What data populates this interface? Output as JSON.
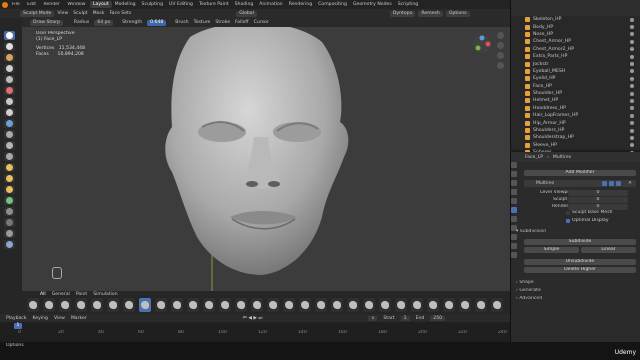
{
  "menu": {
    "items": [
      "File",
      "Edit",
      "Render",
      "Window",
      "Help"
    ]
  },
  "workspace_tabs": [
    "Layout",
    "Modeling",
    "Sculpting",
    "UV Editing",
    "Texture Paint",
    "Shading",
    "Animation",
    "Rendering",
    "Compositing",
    "Geometry Nodes",
    "Scripting"
  ],
  "scene_label": "Scene",
  "viewlayer_label": "ViewLayer",
  "viewport_header": {
    "mode": "Sculpt Mode",
    "items": [
      "View",
      "Sculpt",
      "Mask",
      "Face Sets"
    ],
    "global": "Global",
    "dyntopo": "Dyntopo",
    "remesh": "Remesh",
    "options": "Options"
  },
  "tool_header": {
    "brush_name": "Draw Sharp",
    "radius_label": "Radius",
    "radius_value": "64 px",
    "strength_label": "Strength",
    "strength_value": "0.648",
    "menus": [
      "Brush",
      "Texture",
      "Stroke",
      "Falloff",
      "Cursor"
    ]
  },
  "viewport_info": {
    "line1": "User Perspective",
    "line2": "(1) Face_LP",
    "vertices_label": "Vertices",
    "vertices_value": "11,534,448",
    "faces_label": "Faces",
    "faces_value": "10,894,208"
  },
  "brush_tabs": [
    "All",
    "General",
    "Paint",
    "Simulation"
  ],
  "timeline": {
    "items": [
      "Playback",
      "Keying",
      "View",
      "Marker"
    ],
    "current_frame": "1",
    "start_label": "Start",
    "start_value": "1",
    "end_label": "End",
    "end_value": "250",
    "ticks": [
      "0",
      "20",
      "40",
      "60",
      "80",
      "100",
      "120",
      "140",
      "160",
      "180",
      "200",
      "220",
      "240"
    ]
  },
  "status": {
    "left": "Options"
  },
  "outliner": {
    "items": [
      "Skeleton_HP",
      "Body_HP",
      "Nose_HP",
      "Chest_Armor_HP",
      "Chest_Armor2_HP",
      "Extra_Parts_HP",
      "Jockstr",
      "Eyeball_MESH",
      "Eyelid_HP",
      "Face_HP",
      "Shoulder_HP",
      "Helmet_HP",
      "Headdress_HP",
      "Hair_LopFrames_HP",
      "Hip_Armor_HP",
      "Shoulders_HP",
      "Shoulderstrap_HP",
      "Sleeve_HP",
      "Spheres",
      "UpperLongHair_HP"
    ]
  },
  "properties": {
    "breadcrumb_object": "Face_LP",
    "breadcrumb_modifier": "Multires",
    "add_modifier": "Add Modifier",
    "modifier_name": "Multires",
    "level_viewport_label": "Level Viewport",
    "level_viewport_value": "0",
    "sculpt_label": "Sculpt",
    "sculpt_value": "0",
    "render_label": "Render",
    "render_value": "0",
    "sculpt_base_mesh": "Sculpt Base Mesh",
    "optimal_display": "Optimal Display",
    "subdivision_section": "Subdivision",
    "subdivide": "Subdivide",
    "simple": "Simple",
    "linear": "Linear",
    "unsubdivide": "Unsubdivide",
    "delete_higher": "Delete Higher",
    "shape": "Shape",
    "generate": "Generate",
    "advanced": "Advanced"
  },
  "watermark": "Udemy",
  "colors": {
    "accent_blue": "#4a72b0",
    "orange": "#e87d0d",
    "viewport_bg": "#3c3c3c"
  }
}
